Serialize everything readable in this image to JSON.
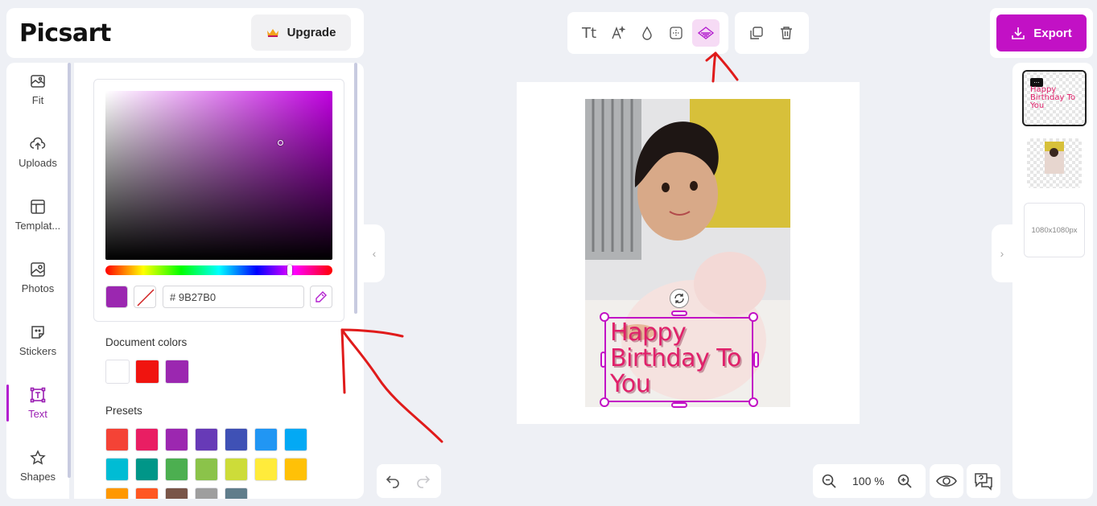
{
  "header": {
    "logo": "Picsart",
    "upgrade_label": "Upgrade",
    "export_label": "Export"
  },
  "sidebar": {
    "items": [
      {
        "label": "Fit",
        "icon": "fit-icon"
      },
      {
        "label": "Uploads",
        "icon": "upload-icon"
      },
      {
        "label": "Templat...",
        "icon": "template-icon"
      },
      {
        "label": "Photos",
        "icon": "photo-icon"
      },
      {
        "label": "Stickers",
        "icon": "sticker-icon"
      },
      {
        "label": "Text",
        "icon": "text-icon",
        "active": true
      },
      {
        "label": "Shapes",
        "icon": "star-icon"
      }
    ]
  },
  "color_panel": {
    "hex_value": "# 9B27B0",
    "current_color": "#9B27B0",
    "document_colors_title": "Document colors",
    "document_colors": [
      "#FFFFFF",
      "#F0140F",
      "#9B27B0"
    ],
    "presets_title": "Presets",
    "presets": [
      "#F44336",
      "#E91E63",
      "#9C27B0",
      "#673AB7",
      "#3F51B5",
      "#2196F3",
      "#03A9F4",
      "#00BCD4",
      "#009688",
      "#4CAF50",
      "#8BC34A",
      "#CDDC39",
      "#FFEB3B",
      "#FFC107",
      "#FF9800",
      "#FF5722",
      "#795548",
      "#9E9E9E",
      "#607D8B"
    ]
  },
  "toolbar": {
    "font_size_icon": "Tt",
    "items": [
      "text-format-icon",
      "text-effects-icon",
      "opacity-icon",
      "position-icon",
      "blend-icon",
      "duplicate-icon",
      "delete-icon"
    ]
  },
  "canvas": {
    "text": "Happy Birthday To You",
    "text_color": "#E0206A"
  },
  "pages": {
    "size_label": "1080x1080px"
  },
  "zoom": {
    "level": "100 %"
  },
  "accent_color": "#C211C5"
}
